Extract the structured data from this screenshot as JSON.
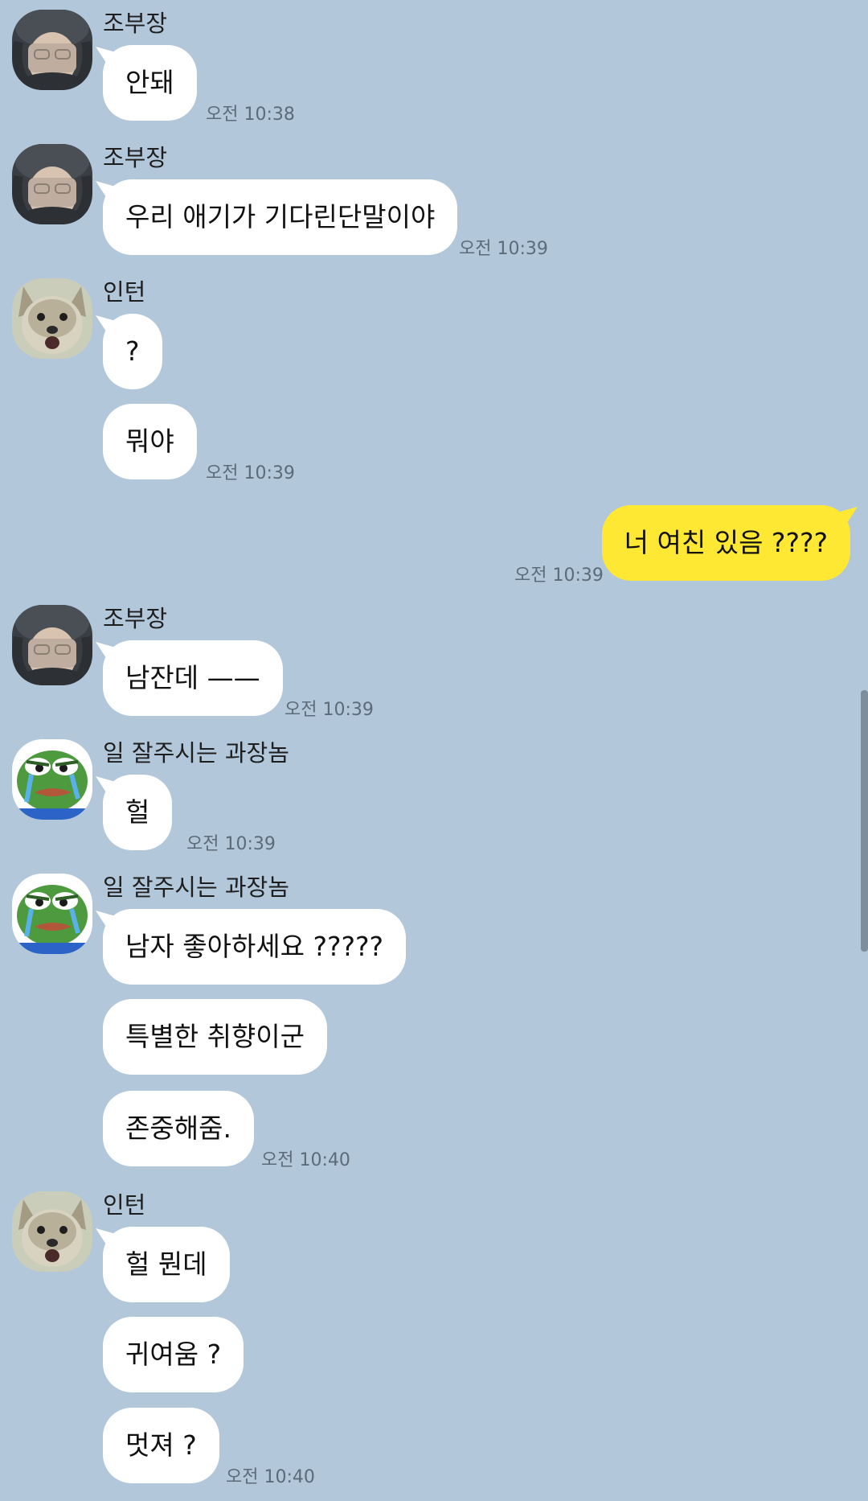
{
  "senders": {
    "jo": "조부장",
    "intern": "인턴",
    "manager": "일 잘주시는 과장놈"
  },
  "messages": {
    "m1": "안돼",
    "m2": "우리 애기가 기다린단말이야",
    "m3": "?",
    "m4": "뭐야",
    "m5": "너 여친 있음 ????",
    "m6": "남잔데 ——",
    "m7": "헐",
    "m8": "남자 좋아하세요 ?????",
    "m9": "특별한 취향이군",
    "m10": "존중해줌.",
    "m11": "헐 뭔데",
    "m12": "귀여움 ?",
    "m13": "멋져 ?"
  },
  "times": {
    "t1": "오전 10:38",
    "t2": "오전 10:39",
    "t3": "오전 10:39",
    "t4": "오전 10:39",
    "t5": "오전 10:39",
    "t6": "오전 10:39",
    "t7": "오전 10:40",
    "t8": "오전 10:40"
  },
  "avatars": {
    "jo": "person-hood-avatar",
    "intern": "shocked-dog-avatar",
    "manager": "crying-frog-avatar"
  },
  "colors": {
    "background": "#b2c7da",
    "bubble_other": "#ffffff",
    "bubble_mine": "#fee833"
  }
}
